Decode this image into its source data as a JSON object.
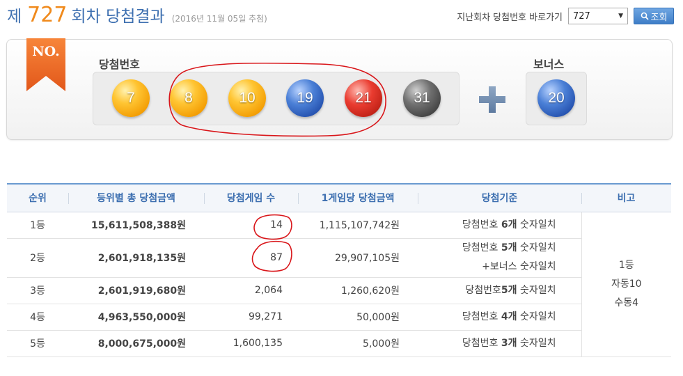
{
  "header": {
    "title_prefix": "제",
    "draw_number": "727",
    "title_suffix": "회차 당첨결과",
    "draw_date": "(2016년 11월 05일 추첨)"
  },
  "goto": {
    "label": "지난회차 당첨번호 바로가기",
    "selected": "727",
    "button_label": "조회"
  },
  "panel": {
    "ribbon_text": "NO.",
    "winning_label": "당첨번호",
    "bonus_label": "보너스",
    "balls": [
      {
        "number": "7",
        "color": "#f5a300"
      },
      {
        "number": "8",
        "color": "#f5a300"
      },
      {
        "number": "10",
        "color": "#f5a300"
      },
      {
        "number": "19",
        "color": "#1f4aa8"
      },
      {
        "number": "21",
        "color": "#c8221a"
      },
      {
        "number": "31",
        "color": "#3b3b3b"
      }
    ],
    "bonus_ball": {
      "number": "20",
      "color": "#1f4aa8"
    }
  },
  "table": {
    "headers": [
      "순위",
      "등위별 총 당첨금액",
      "당첨게임 수",
      "1게임당 당첨금액",
      "당첨기준",
      "비고"
    ],
    "rows": [
      {
        "rank": "1등",
        "total": "15,611,508,388원",
        "games": "14",
        "per_game": "1,115,107,742원",
        "crit_a": "당첨번호 ",
        "crit_b": "6개",
        "crit_c": " 숫자일치",
        "crit2": ""
      },
      {
        "rank": "2등",
        "total": "2,601,918,135원",
        "games": "87",
        "per_game": "29,907,105원",
        "crit_a": "당첨번호 ",
        "crit_b": "5개",
        "crit_c": " 숫자일치",
        "crit2": "+보너스 숫자일치"
      },
      {
        "rank": "3등",
        "total": "2,601,919,680원",
        "games": "2,064",
        "per_game": "1,260,620원",
        "crit_a": "당첨번호",
        "crit_b": "5개",
        "crit_c": " 숫자일치",
        "crit2": ""
      },
      {
        "rank": "4등",
        "total": "4,963,550,000원",
        "games": "99,271",
        "per_game": "50,000원",
        "crit_a": "당첨번호 ",
        "crit_b": "4개",
        "crit_c": " 숫자일치",
        "crit2": ""
      },
      {
        "rank": "5등",
        "total": "8,000,675,000원",
        "games": "1,600,135",
        "per_game": "5,000원",
        "crit_a": "당첨번호 ",
        "crit_b": "3개",
        "crit_c": " 숫자일치",
        "crit2": ""
      }
    ],
    "note": [
      "1등",
      "자동10",
      "수동4"
    ]
  },
  "annotation_color": "#d9161a"
}
